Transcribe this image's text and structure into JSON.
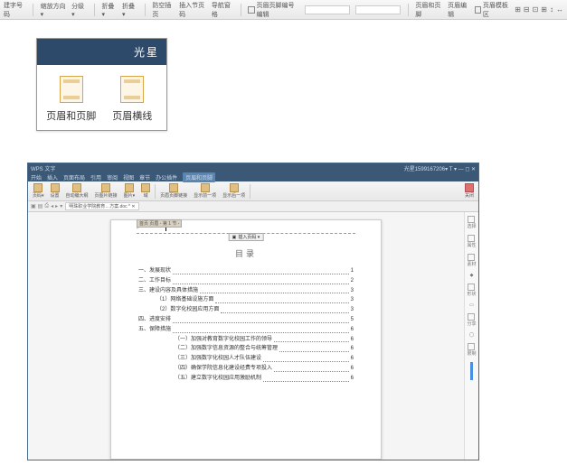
{
  "top_ribbon": {
    "items": [
      "建字号码",
      "缩放方向 ▾",
      "分级 ▾",
      "折叠 ▾",
      "折叠 ▾",
      "防空插页",
      "插入节页码",
      "导航窗格"
    ],
    "fields": [
      "页眉页脚编号编辑",
      "",
      "页眉和页脚",
      "页眉编辑",
      "页眉模板区"
    ],
    "mini": [
      "⊞",
      "⊟",
      "⊡",
      "⊞",
      "↕",
      "↔"
    ]
  },
  "mid": {
    "title": "光星",
    "btn1": "页眉和页脚",
    "btn2": "页眉横线"
  },
  "app": {
    "titlebar": {
      "brand": "WPS 文字",
      "right": "光星1599167206▾  T ▾  —  ◻  ✕"
    },
    "menus": [
      "开始",
      "插入",
      "页面布局",
      "引用",
      "审阅",
      "视图",
      "章节",
      "办公插件"
    ],
    "active_menu": "页眉和页脚",
    "toolbar": [
      "页码▾",
      "设置",
      "自动编大纲",
      "页图片链接",
      "图片▾",
      "域",
      "",
      "页眉页脚链接",
      "显示前一项",
      "显示后一项",
      "",
      "关闭"
    ],
    "qat": [
      "▣",
      "▤",
      "⎙",
      "◂",
      "▸",
      "▾"
    ],
    "doc_tab": "明珠职业学院教育…方案.doc * ✕",
    "header_mark": "⌐",
    "header_tag": "首页 页眉 - 第 1 节 -",
    "pgnum": {
      "ic": "▣",
      "label": "插入页码 ▾"
    },
    "toc_title": "目录",
    "toc": [
      {
        "lvl": 0,
        "txt": "一、发展现状",
        "pg": "1"
      },
      {
        "lvl": 0,
        "txt": "二、工作目标",
        "pg": "2"
      },
      {
        "lvl": 0,
        "txt": "三、建设内容及具体措施",
        "pg": "3"
      },
      {
        "lvl": 1,
        "txt": "（1）网络基础设施方面",
        "pg": "3"
      },
      {
        "lvl": 1,
        "txt": "（2）数字化校园应用方面",
        "pg": "3"
      },
      {
        "lvl": 0,
        "txt": "四、进度安排",
        "pg": "5"
      },
      {
        "lvl": 0,
        "txt": "五、保障措施",
        "pg": "6"
      },
      {
        "lvl": 2,
        "txt": "（一）加强对教育数字化校园工作的领导",
        "pg": "6"
      },
      {
        "lvl": 2,
        "txt": "（二）加强数字信息资源的整合与统筹管理",
        "pg": "6"
      },
      {
        "lvl": 2,
        "txt": "（三）加强数字化校园人才队伍建设",
        "pg": "6"
      },
      {
        "lvl": 2,
        "txt": "（四）确保学院信息化建设经费专项投入",
        "pg": "6"
      },
      {
        "lvl": 2,
        "txt": "（五）建立数字化校园应用激励机制",
        "pg": "6"
      }
    ],
    "sidebar": [
      "选择",
      "属性",
      "素材",
      "◆",
      "形状",
      "▭",
      "分享",
      "◯",
      "限制"
    ]
  }
}
